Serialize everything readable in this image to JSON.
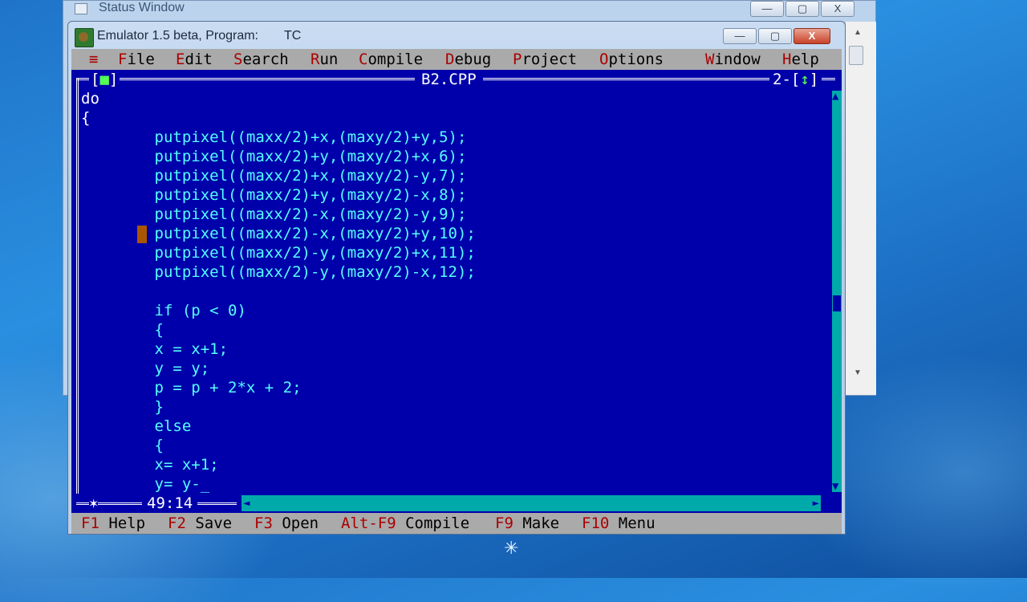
{
  "status_window": {
    "title": "Status Window"
  },
  "emulator_window": {
    "title": "Emulator 1.5 beta, Program:",
    "program": "TC"
  },
  "window_buttons": {
    "minimize": "—",
    "restore": "▢",
    "close": "X"
  },
  "menubar": {
    "system": "≡",
    "items": [
      {
        "hk": "F",
        "rest": "ile"
      },
      {
        "hk": "E",
        "rest": "dit"
      },
      {
        "hk": "S",
        "rest": "earch"
      },
      {
        "hk": "R",
        "rest": "un"
      },
      {
        "hk": "C",
        "rest": "ompile"
      },
      {
        "hk": "D",
        "rest": "ebug"
      },
      {
        "hk": "P",
        "rest": "roject"
      },
      {
        "hk": "O",
        "rest": "ptions"
      },
      {
        "hk": "W",
        "rest": "indow"
      },
      {
        "hk": "H",
        "rest": "elp"
      }
    ]
  },
  "editor": {
    "file_name": "B2.CPP",
    "close_box": "■",
    "window_number": "2",
    "zoom_box": "↕",
    "cursor_position": "49:14",
    "modified_marker": "✶",
    "lines": [
      "do",
      "{",
      "        putpixel((maxx/2)+x,(maxy/2)+y,5);",
      "        putpixel((maxx/2)+y,(maxy/2)+x,6);",
      "        putpixel((maxx/2)+x,(maxy/2)-y,7);",
      "        putpixel((maxx/2)+y,(maxy/2)-x,8);",
      "        putpixel((maxx/2)-x,(maxy/2)-y,9);",
      "        putpixel((maxx/2)-x,(maxy/2)+y,10);",
      "        putpixel((maxx/2)-y,(maxy/2)+x,11);",
      "        putpixel((maxx/2)-y,(maxy/2)-x,12);",
      "",
      "        if (p < 0)",
      "        {",
      "        x = x+1;",
      "        y = y;",
      "        p = p + 2*x + 2;",
      "        }",
      "        else",
      "        {",
      "        x= x+1;",
      "        y= y-_"
    ]
  },
  "statusbar": [
    {
      "key": "F1",
      "label": "Help"
    },
    {
      "key": "F2",
      "label": "Save"
    },
    {
      "key": "F3",
      "label": "Open"
    },
    {
      "key": "Alt-F9",
      "label": "Compile"
    },
    {
      "key": "F9",
      "label": "Make"
    },
    {
      "key": "F10",
      "label": "Menu"
    }
  ],
  "colors": {
    "editor_bg": "#0000aa",
    "menu_bg": "#aaaaaa",
    "hotkey": "#aa0000",
    "code_text": "#ffff55",
    "scrollbar": "#00aaaa"
  }
}
